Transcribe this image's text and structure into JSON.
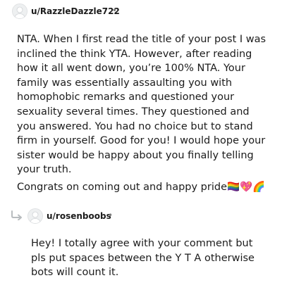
{
  "comments": [
    {
      "username": "u/RazzleDazzle722",
      "separator": "•",
      "paragraphs": [
        "NTA. When I first read the title of your post I was inclined the think YTA. However, after reading how it all went down, you’re 100% NTA. Your family was essentially assaulting you with homophobic remarks and questioned your sexuality several times. They questioned and you answered. You had no choice but to stand firm in yourself. Good for you! I would hope your sister would be happy about you finally telling your truth.",
        "Congrats on coming out and happy pride🏳️‍🌈💖🌈"
      ]
    },
    {
      "username": "u/rosenboobs",
      "separator": "•",
      "paragraphs": [
        "Hey! I totally agree with your comment but pls put spaces between the Y T A otherwise bots will count it."
      ]
    }
  ],
  "icons": {
    "avatar": "default-avatar-icon",
    "reply": "reply-arrow-icon"
  },
  "colors": {
    "text": "#1c1c1c",
    "meta": "#7c7c7c",
    "avatar_bg": "#f2f3f4"
  }
}
